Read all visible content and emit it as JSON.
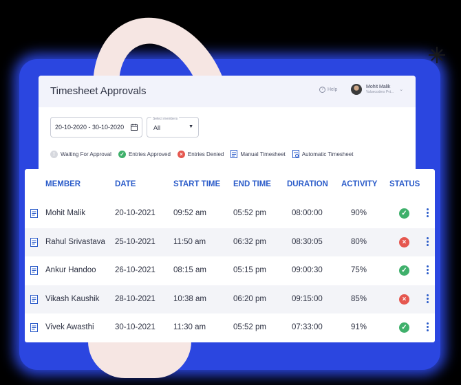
{
  "header": {
    "title": "Timesheet Approvals",
    "help_label": "Help",
    "user_name": "Mohit Malik",
    "user_company": "Valuecoders Pvt..."
  },
  "filters": {
    "date_range": "20-10-2020 - 30-10-2020",
    "members_label": "Select members",
    "members_value": "All"
  },
  "legend": [
    {
      "label": "Waiting For Approval"
    },
    {
      "label": "Entries Approved"
    },
    {
      "label": "Entries Denied"
    },
    {
      "label": "Manual Timesheet"
    },
    {
      "label": "Automatic Timesheet"
    }
  ],
  "table": {
    "columns": [
      "MEMBER",
      "DATE",
      "START TIME",
      "END TIME",
      "DURATION",
      "ACTIVITY",
      "STATUS"
    ],
    "rows": [
      {
        "member": "Mohit Malik",
        "date": "20-10-2021",
        "start": "09:52 am",
        "end": "05:52 pm",
        "duration": "08:00:00",
        "activity": "90%",
        "status": "approved"
      },
      {
        "member": "Rahul Srivastava",
        "date": "25-10-2021",
        "start": "11:50 am",
        "end": "06:32 pm",
        "duration": "08:30:05",
        "activity": "80%",
        "status": "denied"
      },
      {
        "member": "Ankur Handoo",
        "date": "26-10-2021",
        "start": "08:15 am",
        "end": "05:15 pm",
        "duration": "09:00:30",
        "activity": "75%",
        "status": "approved"
      },
      {
        "member": "Vikash Kaushik",
        "date": "28-10-2021",
        "start": "10:38 am",
        "end": "06:20 pm",
        "duration": "09:15:00",
        "activity": "85%",
        "status": "denied"
      },
      {
        "member": "Vivek Awasthi",
        "date": "30-10-2021",
        "start": "11:30 am",
        "end": "05:52 pm",
        "duration": "07:33:00",
        "activity": "91%",
        "status": "approved"
      }
    ]
  },
  "colors": {
    "accent": "#2a5bc9",
    "approved": "#3fb06b",
    "denied": "#e5574f",
    "backdrop": "#2b46e0"
  }
}
